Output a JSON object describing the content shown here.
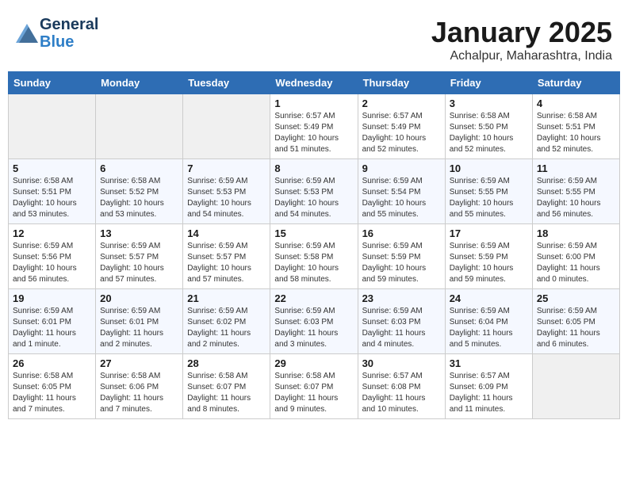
{
  "header": {
    "logo_text_general": "General",
    "logo_text_blue": "Blue",
    "month_title": "January 2025",
    "location": "Achalpur, Maharashtra, India"
  },
  "weekdays": [
    "Sunday",
    "Monday",
    "Tuesday",
    "Wednesday",
    "Thursday",
    "Friday",
    "Saturday"
  ],
  "weeks": [
    [
      {
        "day": "",
        "info": ""
      },
      {
        "day": "",
        "info": ""
      },
      {
        "day": "",
        "info": ""
      },
      {
        "day": "1",
        "info": "Sunrise: 6:57 AM\nSunset: 5:49 PM\nDaylight: 10 hours\nand 51 minutes."
      },
      {
        "day": "2",
        "info": "Sunrise: 6:57 AM\nSunset: 5:49 PM\nDaylight: 10 hours\nand 52 minutes."
      },
      {
        "day": "3",
        "info": "Sunrise: 6:58 AM\nSunset: 5:50 PM\nDaylight: 10 hours\nand 52 minutes."
      },
      {
        "day": "4",
        "info": "Sunrise: 6:58 AM\nSunset: 5:51 PM\nDaylight: 10 hours\nand 52 minutes."
      }
    ],
    [
      {
        "day": "5",
        "info": "Sunrise: 6:58 AM\nSunset: 5:51 PM\nDaylight: 10 hours\nand 53 minutes."
      },
      {
        "day": "6",
        "info": "Sunrise: 6:58 AM\nSunset: 5:52 PM\nDaylight: 10 hours\nand 53 minutes."
      },
      {
        "day": "7",
        "info": "Sunrise: 6:59 AM\nSunset: 5:53 PM\nDaylight: 10 hours\nand 54 minutes."
      },
      {
        "day": "8",
        "info": "Sunrise: 6:59 AM\nSunset: 5:53 PM\nDaylight: 10 hours\nand 54 minutes."
      },
      {
        "day": "9",
        "info": "Sunrise: 6:59 AM\nSunset: 5:54 PM\nDaylight: 10 hours\nand 55 minutes."
      },
      {
        "day": "10",
        "info": "Sunrise: 6:59 AM\nSunset: 5:55 PM\nDaylight: 10 hours\nand 55 minutes."
      },
      {
        "day": "11",
        "info": "Sunrise: 6:59 AM\nSunset: 5:55 PM\nDaylight: 10 hours\nand 56 minutes."
      }
    ],
    [
      {
        "day": "12",
        "info": "Sunrise: 6:59 AM\nSunset: 5:56 PM\nDaylight: 10 hours\nand 56 minutes."
      },
      {
        "day": "13",
        "info": "Sunrise: 6:59 AM\nSunset: 5:57 PM\nDaylight: 10 hours\nand 57 minutes."
      },
      {
        "day": "14",
        "info": "Sunrise: 6:59 AM\nSunset: 5:57 PM\nDaylight: 10 hours\nand 57 minutes."
      },
      {
        "day": "15",
        "info": "Sunrise: 6:59 AM\nSunset: 5:58 PM\nDaylight: 10 hours\nand 58 minutes."
      },
      {
        "day": "16",
        "info": "Sunrise: 6:59 AM\nSunset: 5:59 PM\nDaylight: 10 hours\nand 59 minutes."
      },
      {
        "day": "17",
        "info": "Sunrise: 6:59 AM\nSunset: 5:59 PM\nDaylight: 10 hours\nand 59 minutes."
      },
      {
        "day": "18",
        "info": "Sunrise: 6:59 AM\nSunset: 6:00 PM\nDaylight: 11 hours\nand 0 minutes."
      }
    ],
    [
      {
        "day": "19",
        "info": "Sunrise: 6:59 AM\nSunset: 6:01 PM\nDaylight: 11 hours\nand 1 minute."
      },
      {
        "day": "20",
        "info": "Sunrise: 6:59 AM\nSunset: 6:01 PM\nDaylight: 11 hours\nand 2 minutes."
      },
      {
        "day": "21",
        "info": "Sunrise: 6:59 AM\nSunset: 6:02 PM\nDaylight: 11 hours\nand 2 minutes."
      },
      {
        "day": "22",
        "info": "Sunrise: 6:59 AM\nSunset: 6:03 PM\nDaylight: 11 hours\nand 3 minutes."
      },
      {
        "day": "23",
        "info": "Sunrise: 6:59 AM\nSunset: 6:03 PM\nDaylight: 11 hours\nand 4 minutes."
      },
      {
        "day": "24",
        "info": "Sunrise: 6:59 AM\nSunset: 6:04 PM\nDaylight: 11 hours\nand 5 minutes."
      },
      {
        "day": "25",
        "info": "Sunrise: 6:59 AM\nSunset: 6:05 PM\nDaylight: 11 hours\nand 6 minutes."
      }
    ],
    [
      {
        "day": "26",
        "info": "Sunrise: 6:58 AM\nSunset: 6:05 PM\nDaylight: 11 hours\nand 7 minutes."
      },
      {
        "day": "27",
        "info": "Sunrise: 6:58 AM\nSunset: 6:06 PM\nDaylight: 11 hours\nand 7 minutes."
      },
      {
        "day": "28",
        "info": "Sunrise: 6:58 AM\nSunset: 6:07 PM\nDaylight: 11 hours\nand 8 minutes."
      },
      {
        "day": "29",
        "info": "Sunrise: 6:58 AM\nSunset: 6:07 PM\nDaylight: 11 hours\nand 9 minutes."
      },
      {
        "day": "30",
        "info": "Sunrise: 6:57 AM\nSunset: 6:08 PM\nDaylight: 11 hours\nand 10 minutes."
      },
      {
        "day": "31",
        "info": "Sunrise: 6:57 AM\nSunset: 6:09 PM\nDaylight: 11 hours\nand 11 minutes."
      },
      {
        "day": "",
        "info": ""
      }
    ]
  ]
}
